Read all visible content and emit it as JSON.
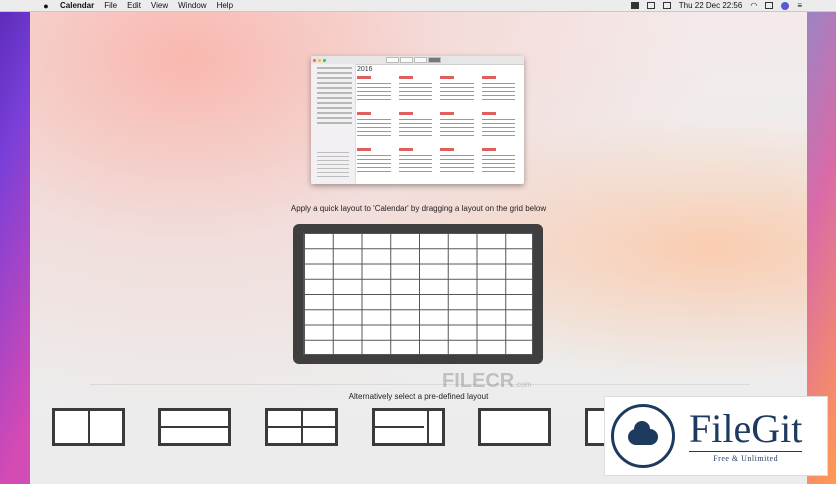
{
  "menubar": {
    "app_name": "Calendar",
    "menus": [
      "File",
      "Edit",
      "View",
      "Window",
      "Help"
    ],
    "clock": "Thu 22 Dec  22:56"
  },
  "preview": {
    "year": "2016"
  },
  "instructions": {
    "quick_layout": "Apply a quick layout to 'Calendar' by dragging a layout on the grid below",
    "predefined": "Alternatively select a pre-defined layout"
  },
  "layouts": [
    {
      "name": "halves-vertical"
    },
    {
      "name": "halves-horizontal"
    },
    {
      "name": "quarters"
    },
    {
      "name": "three-columns-split"
    },
    {
      "name": "full-screen"
    },
    {
      "name": "partial-hidden"
    }
  ],
  "watermark": {
    "text": "FILECR",
    "suffix": ".com"
  },
  "badge": {
    "name": "FileGit",
    "tagline": "Free & Unlimited"
  }
}
